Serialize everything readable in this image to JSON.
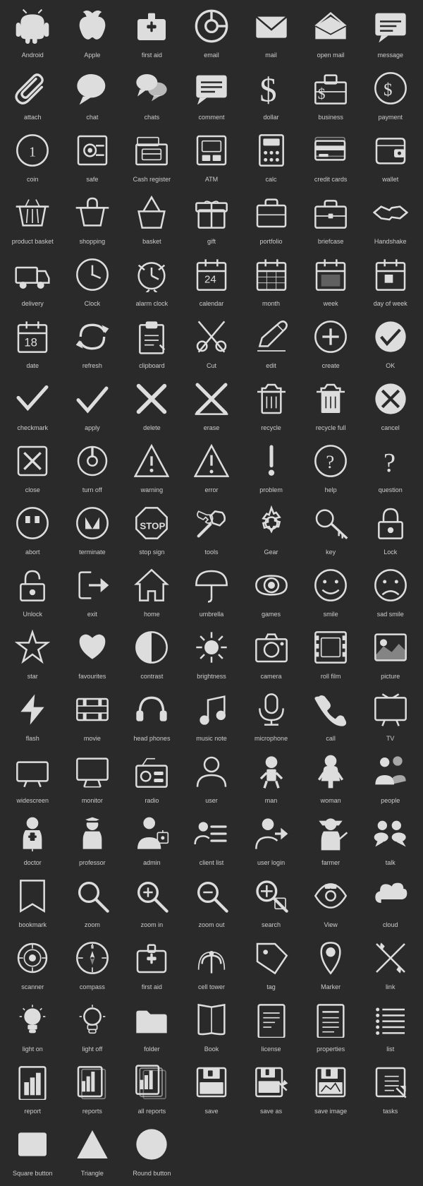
{
  "icons": [
    {
      "id": "android",
      "label": "Android",
      "shape": "android"
    },
    {
      "id": "apple",
      "label": "Apple",
      "shape": "apple"
    },
    {
      "id": "first-aid",
      "label": "first aid",
      "shape": "firstaid"
    },
    {
      "id": "email",
      "label": "email",
      "shape": "email"
    },
    {
      "id": "mail",
      "label": "mail",
      "shape": "mail"
    },
    {
      "id": "open-mail",
      "label": "open mail",
      "shape": "openmail"
    },
    {
      "id": "message",
      "label": "message",
      "shape": "message"
    },
    {
      "id": "attach",
      "label": "attach",
      "shape": "attach"
    },
    {
      "id": "chat",
      "label": "chat",
      "shape": "chat"
    },
    {
      "id": "chats",
      "label": "chats",
      "shape": "chats"
    },
    {
      "id": "comment",
      "label": "comment",
      "shape": "comment"
    },
    {
      "id": "dollar",
      "label": "dollar",
      "shape": "dollar"
    },
    {
      "id": "business",
      "label": "business",
      "shape": "business"
    },
    {
      "id": "payment",
      "label": "payment",
      "shape": "payment"
    },
    {
      "id": "coin",
      "label": "coin",
      "shape": "coin"
    },
    {
      "id": "safe",
      "label": "safe",
      "shape": "safe"
    },
    {
      "id": "cash-register",
      "label": "Cash register",
      "shape": "cashregister"
    },
    {
      "id": "atm",
      "label": "ATM",
      "shape": "atm"
    },
    {
      "id": "calc",
      "label": "calc",
      "shape": "calc"
    },
    {
      "id": "credit-cards",
      "label": "credit cards",
      "shape": "creditcards"
    },
    {
      "id": "wallet",
      "label": "wallet",
      "shape": "wallet"
    },
    {
      "id": "product-basket",
      "label": "product basket",
      "shape": "productbasket"
    },
    {
      "id": "shopping",
      "label": "shopping",
      "shape": "shopping"
    },
    {
      "id": "basket",
      "label": "basket",
      "shape": "basket"
    },
    {
      "id": "gift",
      "label": "gift",
      "shape": "gift"
    },
    {
      "id": "portfolio",
      "label": "portfolio",
      "shape": "portfolio"
    },
    {
      "id": "briefcase",
      "label": "briefcase",
      "shape": "briefcase"
    },
    {
      "id": "handshake",
      "label": "Handshake",
      "shape": "handshake"
    },
    {
      "id": "delivery",
      "label": "delivery",
      "shape": "delivery"
    },
    {
      "id": "clock",
      "label": "Clock",
      "shape": "clock"
    },
    {
      "id": "alarm-clock",
      "label": "alarm clock",
      "shape": "alarmclock"
    },
    {
      "id": "calendar",
      "label": "calendar",
      "shape": "calendar"
    },
    {
      "id": "month",
      "label": "month",
      "shape": "month"
    },
    {
      "id": "week",
      "label": "week",
      "shape": "week"
    },
    {
      "id": "day-of-week",
      "label": "day of week",
      "shape": "dayofweek"
    },
    {
      "id": "date",
      "label": "date",
      "shape": "date"
    },
    {
      "id": "refresh",
      "label": "refresh",
      "shape": "refresh"
    },
    {
      "id": "clipboard",
      "label": "clipboard",
      "shape": "clipboard"
    },
    {
      "id": "cut",
      "label": "Cut",
      "shape": "cut"
    },
    {
      "id": "edit",
      "label": "edit",
      "shape": "edit"
    },
    {
      "id": "create",
      "label": "create",
      "shape": "create"
    },
    {
      "id": "ok",
      "label": "OK",
      "shape": "ok"
    },
    {
      "id": "checkmark",
      "label": "checkmark",
      "shape": "checkmark"
    },
    {
      "id": "apply",
      "label": "apply",
      "shape": "apply"
    },
    {
      "id": "delete",
      "label": "delete",
      "shape": "delete"
    },
    {
      "id": "erase",
      "label": "erase",
      "shape": "erase"
    },
    {
      "id": "recycle",
      "label": "recycle",
      "shape": "recycle"
    },
    {
      "id": "recycle-full",
      "label": "recycle full",
      "shape": "recyclefull"
    },
    {
      "id": "cancel",
      "label": "cancel",
      "shape": "cancel"
    },
    {
      "id": "close",
      "label": "close",
      "shape": "close"
    },
    {
      "id": "turn-off",
      "label": "turn off",
      "shape": "turnoff"
    },
    {
      "id": "warning",
      "label": "warning",
      "shape": "warning"
    },
    {
      "id": "error",
      "label": "error",
      "shape": "error"
    },
    {
      "id": "problem",
      "label": "problem",
      "shape": "problem"
    },
    {
      "id": "help",
      "label": "help",
      "shape": "help"
    },
    {
      "id": "question",
      "label": "question",
      "shape": "question"
    },
    {
      "id": "abort",
      "label": "abort",
      "shape": "abort"
    },
    {
      "id": "terminate",
      "label": "terminate",
      "shape": "terminate"
    },
    {
      "id": "stop-sign",
      "label": "stop sign",
      "shape": "stopsign"
    },
    {
      "id": "tools",
      "label": "tools",
      "shape": "tools"
    },
    {
      "id": "gear",
      "label": "Gear",
      "shape": "gear"
    },
    {
      "id": "key",
      "label": "key",
      "shape": "key"
    },
    {
      "id": "lock",
      "label": "Lock",
      "shape": "lock"
    },
    {
      "id": "unlock",
      "label": "Unlock",
      "shape": "unlock"
    },
    {
      "id": "exit",
      "label": "exit",
      "shape": "exit"
    },
    {
      "id": "home",
      "label": "home",
      "shape": "home"
    },
    {
      "id": "umbrella",
      "label": "umbrella",
      "shape": "umbrella"
    },
    {
      "id": "games",
      "label": "games",
      "shape": "games"
    },
    {
      "id": "smile",
      "label": "smile",
      "shape": "smile"
    },
    {
      "id": "sad-smile",
      "label": "sad smile",
      "shape": "sadsmile"
    },
    {
      "id": "star",
      "label": "star",
      "shape": "star"
    },
    {
      "id": "favourites",
      "label": "favourites",
      "shape": "favourites"
    },
    {
      "id": "contrast",
      "label": "contrast",
      "shape": "contrast"
    },
    {
      "id": "brightness",
      "label": "brightness",
      "shape": "brightness"
    },
    {
      "id": "camera",
      "label": "camera",
      "shape": "camera"
    },
    {
      "id": "roll-film",
      "label": "roll film",
      "shape": "rollfilm"
    },
    {
      "id": "picture",
      "label": "picture",
      "shape": "picture"
    },
    {
      "id": "flash",
      "label": "flash",
      "shape": "flash"
    },
    {
      "id": "movie",
      "label": "movie",
      "shape": "movie"
    },
    {
      "id": "head-phones",
      "label": "head phones",
      "shape": "headphones"
    },
    {
      "id": "music-note",
      "label": "music note",
      "shape": "musicnote"
    },
    {
      "id": "microphone",
      "label": "microphone",
      "shape": "microphone"
    },
    {
      "id": "call",
      "label": "call",
      "shape": "call"
    },
    {
      "id": "tv",
      "label": "TV",
      "shape": "tv"
    },
    {
      "id": "widescreen",
      "label": "widescreen",
      "shape": "widescreen"
    },
    {
      "id": "monitor",
      "label": "monitor",
      "shape": "monitor"
    },
    {
      "id": "radio",
      "label": "radio",
      "shape": "radio"
    },
    {
      "id": "user",
      "label": "user",
      "shape": "user"
    },
    {
      "id": "man",
      "label": "man",
      "shape": "man"
    },
    {
      "id": "woman",
      "label": "woman",
      "shape": "woman"
    },
    {
      "id": "people",
      "label": "people",
      "shape": "people"
    },
    {
      "id": "doctor",
      "label": "doctor",
      "shape": "doctor"
    },
    {
      "id": "professor",
      "label": "professor",
      "shape": "professor"
    },
    {
      "id": "admin",
      "label": "admin",
      "shape": "admin"
    },
    {
      "id": "client-list",
      "label": "client list",
      "shape": "clientlist"
    },
    {
      "id": "user-login",
      "label": "user login",
      "shape": "userlogin"
    },
    {
      "id": "farmer",
      "label": "farmer",
      "shape": "farmer"
    },
    {
      "id": "talk",
      "label": "talk",
      "shape": "talk"
    },
    {
      "id": "bookmark",
      "label": "bookmark",
      "shape": "bookmark"
    },
    {
      "id": "zoom",
      "label": "zoom",
      "shape": "zoom"
    },
    {
      "id": "zoom-in",
      "label": "zoom in",
      "shape": "zoomin"
    },
    {
      "id": "zoom-out",
      "label": "zoom out",
      "shape": "zoomout"
    },
    {
      "id": "search",
      "label": "search",
      "shape": "search"
    },
    {
      "id": "view",
      "label": "View",
      "shape": "view"
    },
    {
      "id": "cloud",
      "label": "cloud",
      "shape": "cloud"
    },
    {
      "id": "scanner",
      "label": "scanner",
      "shape": "scanner"
    },
    {
      "id": "compass",
      "label": "compass",
      "shape": "compass"
    },
    {
      "id": "first-aid2",
      "label": "first aid",
      "shape": "firstaid2"
    },
    {
      "id": "cell-tower",
      "label": "cell tower",
      "shape": "celltower"
    },
    {
      "id": "tag",
      "label": "tag",
      "shape": "tag"
    },
    {
      "id": "marker",
      "label": "Marker",
      "shape": "marker"
    },
    {
      "id": "link",
      "label": "link",
      "shape": "link"
    },
    {
      "id": "light-on",
      "label": "light on",
      "shape": "lighton"
    },
    {
      "id": "light-off",
      "label": "light off",
      "shape": "lightoff"
    },
    {
      "id": "folder",
      "label": "folder",
      "shape": "folder"
    },
    {
      "id": "book",
      "label": "Book",
      "shape": "book"
    },
    {
      "id": "license",
      "label": "license",
      "shape": "license"
    },
    {
      "id": "properties",
      "label": "properties",
      "shape": "properties"
    },
    {
      "id": "list",
      "label": "list",
      "shape": "list"
    },
    {
      "id": "report",
      "label": "report",
      "shape": "report"
    },
    {
      "id": "reports",
      "label": "reports",
      "shape": "reports"
    },
    {
      "id": "all-reports",
      "label": "all reports",
      "shape": "allreports"
    },
    {
      "id": "save",
      "label": "save",
      "shape": "save"
    },
    {
      "id": "save-as",
      "label": "save as",
      "shape": "saveas"
    },
    {
      "id": "save-image",
      "label": "save image",
      "shape": "saveimage"
    },
    {
      "id": "tasks",
      "label": "tasks",
      "shape": "tasks"
    },
    {
      "id": "square-button",
      "label": "Square button",
      "shape": "squarebutton"
    },
    {
      "id": "triangle",
      "label": "Triangle",
      "shape": "triangle"
    },
    {
      "id": "round-button",
      "label": "Round button",
      "shape": "roundbutton"
    }
  ]
}
